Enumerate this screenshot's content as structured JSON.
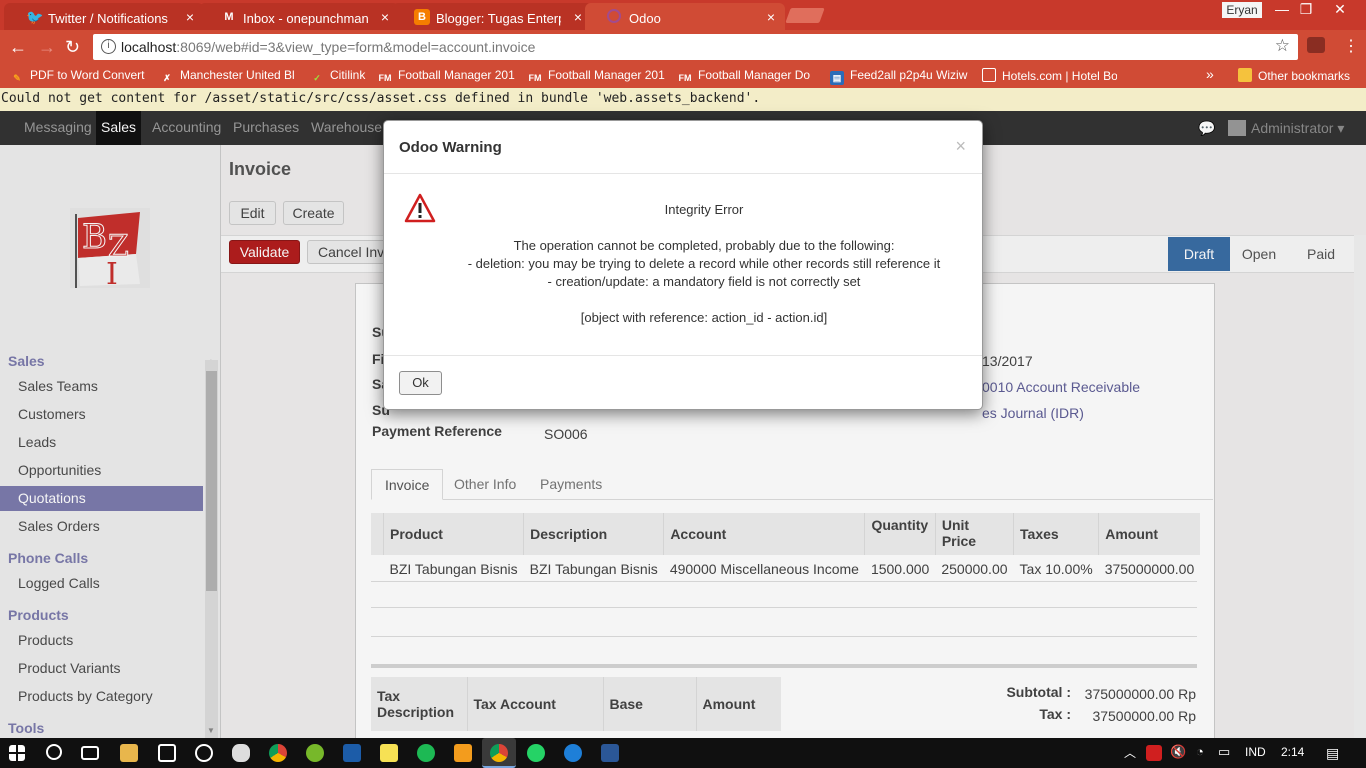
{
  "browser": {
    "tabs": [
      {
        "label": "Twitter / Notifications",
        "icon": "twitter-icon",
        "close": "×"
      },
      {
        "label": "Inbox - onepunchman.up",
        "icon": "gmail-icon",
        "close": "×"
      },
      {
        "label": "Blogger: Tugas Enterprise",
        "icon": "blogger-icon",
        "close": "×"
      },
      {
        "label": "Odoo",
        "icon": "odoo-icon",
        "close": "×"
      }
    ],
    "user": "Eryan",
    "window_controls": {
      "minimize": "—",
      "restore": "❐",
      "close": "✕"
    },
    "url_host": "localhost",
    "url_rest": ":8069/web#id=3&view_type=form&model=account.invoice",
    "bookmarks": [
      "PDF to Word Convert",
      "Manchester United Bl",
      "Citilink",
      "Football Manager 201",
      "Football Manager 201",
      "Football Manager Do",
      "Feed2all p2p4u Wiziw",
      "Hotels.com | Hotel Bo"
    ],
    "bookmarks_more": "»",
    "other_bookmarks": "Other bookmarks"
  },
  "error_bar": "Could not get content for /asset/static/src/css/asset.css defined in bundle 'web.assets_backend'.",
  "topmenu": {
    "items": [
      "Messaging",
      "Sales",
      "Accounting",
      "Purchases",
      "Warehouse"
    ],
    "active": "Sales",
    "user": "Administrator ▾"
  },
  "sidebar": {
    "sections": [
      {
        "title": "Sales",
        "items": [
          "Sales Teams",
          "Customers",
          "Leads",
          "Opportunities",
          "Quotations",
          "Sales Orders"
        ]
      },
      {
        "title": "Phone Calls",
        "items": [
          "Logged Calls"
        ]
      },
      {
        "title": "Products",
        "items": [
          "Products",
          "Product Variants",
          "Products by Category"
        ]
      },
      {
        "title": "Tools",
        "items": []
      }
    ],
    "active_item": "Quotations"
  },
  "form": {
    "breadcrumb": "Invoice",
    "edit": "Edit",
    "create": "Create",
    "validate": "Validate",
    "cancel": "Cancel Invo",
    "stages": [
      "Draft",
      "Open",
      "Paid"
    ],
    "current_stage": "Draft",
    "left_labels_partial": [
      "Su",
      "Fi",
      "Sa",
      "Su"
    ],
    "payment_reference_label": "Payment Reference",
    "payment_reference": "SO006",
    "date_partial": "13/2017",
    "account_partial": "0010 Account Receivable",
    "journal_partial": "es Journal (IDR)",
    "tabs": [
      "Invoice",
      "Other Info",
      "Payments"
    ],
    "active_tab": "Invoice",
    "columns": [
      "Product",
      "Description",
      "Account",
      "Quantity",
      "Unit Price",
      "Taxes",
      "Amount"
    ],
    "lines": [
      {
        "product": "BZI Tabungan Bisnis",
        "description": "BZI Tabungan Bisnis",
        "account": "490000 Miscellaneous Income",
        "quantity": "1500.000",
        "unit_price": "250000.00",
        "taxes": "Tax 10.00%",
        "amount": "375000000.00"
      }
    ],
    "tax_columns": [
      "Tax Description",
      "Tax Account",
      "Base",
      "Amount"
    ],
    "subtotal_label": "Subtotal :",
    "subtotal": "375000000.00 Rp",
    "tax_label": "Tax :",
    "tax": "37500000.00 Rp"
  },
  "dialog": {
    "title": "Odoo Warning",
    "close": "×",
    "heading": "Integrity Error",
    "line1": "The operation cannot be completed, probably due to the following:",
    "line2": "- deletion: you may be trying to delete a record while other records still reference it",
    "line3": "- creation/update: a mandatory field is not correctly set",
    "line4": "[object with reference: action_id - action.id]",
    "ok": "Ok"
  },
  "taskbar": {
    "lang": "IND",
    "time": "2:14"
  }
}
